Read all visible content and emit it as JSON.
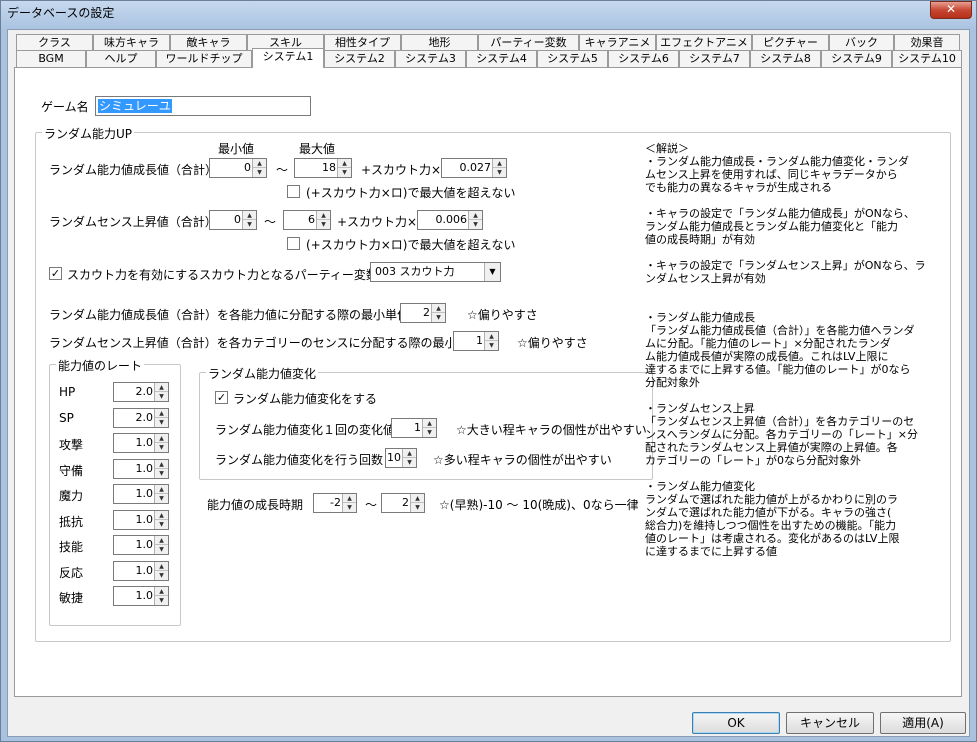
{
  "window": {
    "title": "データベースの設定",
    "close_label": "✕"
  },
  "tabs_row1": [
    "クラス",
    "味方キャラ",
    "敵キャラ",
    "スキル",
    "相性タイプ",
    "地形",
    "パーティー変数",
    "キャラアニメ",
    "エフェクトアニメ",
    "ピクチャー",
    "バック",
    "効果音"
  ],
  "tabs_row2": [
    "BGM",
    "ヘルプ",
    "ワールドチップ",
    "システム1",
    "システム2",
    "システム3",
    "システム4",
    "システム5",
    "システム6",
    "システム7",
    "システム8",
    "システム9",
    "システム10"
  ],
  "active_tab": "システム1",
  "game_name": {
    "label": "ゲーム名",
    "value": "シミュレーユ"
  },
  "random_up": {
    "group_title": "ランダム能力UP",
    "min_label": "最小値",
    "max_label": "最大値",
    "growth_label": "ランダム能力値成長値（合計）",
    "growth_min": "0",
    "growth_tilde": "～",
    "growth_max": "18",
    "growth_scout_label": "+スカウト力×",
    "growth_scout_val": "0.027",
    "growth_cap_label": "(+スカウト力×ロ)で最大値を超えない",
    "sense_label": "ランダムセンス上昇値（合計）",
    "sense_min": "0",
    "sense_tilde": "～",
    "sense_max": "6",
    "sense_scout_label": "+スカウト力×",
    "sense_scout_val": "0.006",
    "sense_cap_label": "(+スカウト力×ロ)で最大値を超えない",
    "scout_enable_label": "スカウト力を有効にする",
    "scout_var_label": "スカウト力となるパーティー変数",
    "scout_var_value": "003 スカウト力",
    "dist_growth_label": "ランダム能力値成長値（合計）を各能力値に分配する際の最小単位",
    "dist_growth_val": "2",
    "dist_growth_note": "☆偏りやすさ",
    "dist_sense_label": "ランダムセンス上昇値（合計）を各カテゴリーのセンスに分配する際の最小単位",
    "dist_sense_val": "1",
    "dist_sense_note": "☆偏りやすさ"
  },
  "rates": {
    "title": "能力値のレート",
    "items": [
      {
        "label": "HP",
        "value": "2.0"
      },
      {
        "label": "SP",
        "value": "2.0"
      },
      {
        "label": "攻撃",
        "value": "1.0"
      },
      {
        "label": "守備",
        "value": "1.0"
      },
      {
        "label": "魔力",
        "value": "1.0"
      },
      {
        "label": "抵抗",
        "value": "1.0"
      },
      {
        "label": "技能",
        "value": "1.0"
      },
      {
        "label": "反応",
        "value": "1.0"
      },
      {
        "label": "敏捷",
        "value": "1.0"
      }
    ]
  },
  "random_change": {
    "title": "ランダム能力値変化",
    "enable_label": "ランダム能力値変化をする",
    "amount_label": "ランダム能力値変化１回の変化値",
    "amount_val": "1",
    "amount_note": "☆大きい程キャラの個性が出やすい",
    "count_label": "ランダム能力値変化を行う回数",
    "count_val": "10",
    "count_note": "☆多い程キャラの個性が出やすい"
  },
  "growth_period": {
    "label": "能力値の成長時期",
    "min": "-2",
    "tilde": "～",
    "max": "2",
    "note": "☆(早熟)-10 ～ 10(晩成)、0なら一律"
  },
  "help_lines": [
    "＜解説＞",
    "・ランダム能力値成長・ランダム能力値変化・ランダ",
    "ムセンス上昇を使用すれば、同じキャラデータから",
    "でも能力の異なるキャラが生成される",
    "",
    "・キャラの設定で「ランダム能力値成長」がONなら、",
    "ランダム能力値成長とランダム能力値変化と「能力",
    "値の成長時期」が有効",
    "",
    "・キャラの設定で「ランダムセンス上昇」がONなら、ラ",
    "ンダムセンス上昇が有効",
    "",
    "",
    "・ランダム能力値成長",
    "「ランダム能力値成長値（合計）」を各能力値へランダ",
    "ムに分配。「能力値のレート」×分配されたランダ",
    "ム能力値成長値が実際の成長値。これはLV上限に",
    "達するまでに上昇する値。「能力値のレート」が0なら",
    "分配対象外",
    "",
    "・ランダムセンス上昇",
    "「ランダムセンス上昇値（合計）」を各カテゴリーのセ",
    "ンスへランダムに分配。各カテゴリーの「レート」×分",
    "配されたランダムセンス上昇値が実際の上昇値。各",
    "カテゴリーの「レート」が0なら分配対象外",
    "",
    "・ランダム能力値変化",
    "ランダムで選ばれた能力値が上がるかわりに別のラ",
    "ンダムで選ばれた能力値が下がる。キャラの強さ(",
    "総合力)を維持しつつ個性を出すための機能。「能力",
    "値のレート」は考慮される。変化があるのはLV上限",
    "に達するまでに上昇する値"
  ],
  "buttons": {
    "ok": "OK",
    "cancel": "キャンセル",
    "apply": "適用(A)"
  }
}
